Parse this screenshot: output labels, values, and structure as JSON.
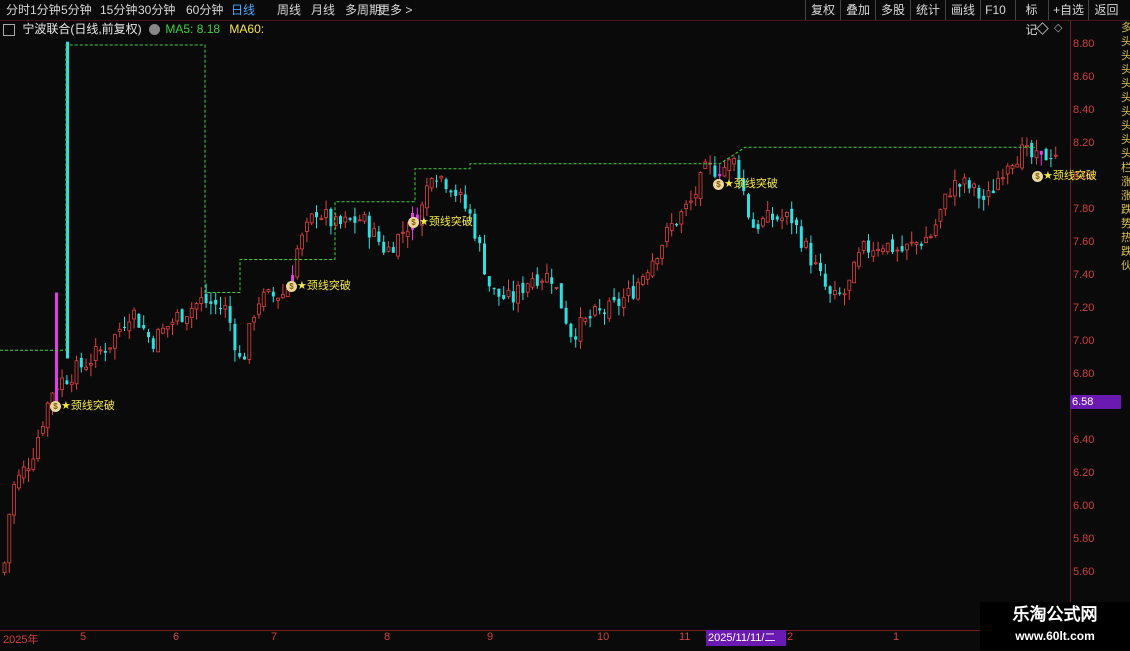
{
  "toolbar": {
    "periods": [
      "分时",
      "1分钟",
      "5分钟",
      "15分钟",
      "30分钟",
      "60分钟",
      "日线",
      "周线",
      "月线",
      "多周期",
      "更多 >"
    ],
    "active_period": "日线",
    "right_buttons": [
      "复权",
      "叠加",
      "多股",
      "统计",
      "画线",
      "F10",
      "标记",
      "+自选",
      "返回"
    ]
  },
  "info": {
    "title": "宁波联合(日线,前复权)",
    "ma5_label": "MA5:",
    "ma5_value": "8.18",
    "ma60_label": "MA60:"
  },
  "y_axis_labels": [
    "8.80",
    "8.60",
    "8.40",
    "8.20",
    "8.00",
    "7.80",
    "7.60",
    "7.40",
    "7.20",
    "7.00",
    "6.80",
    "6.40",
    "6.20",
    "6.00",
    "5.80",
    "5.60"
  ],
  "current_price": "6.58",
  "x_axis_labels": [
    "2025年",
    "5",
    "6",
    "7",
    "8",
    "9",
    "10",
    "11",
    "2025/11/11/二",
    "2",
    "1"
  ],
  "signal_label": "颈线突破",
  "sidebar_text": "多头头头头头头头头头栏涨涨跌势热跌伙",
  "watermark": {
    "line1": "乐淘公式网",
    "line2": "www.60lt.com"
  },
  "colors": {
    "up": "#e04040",
    "down": "#30e0e0",
    "highlight": "#e040e0",
    "ma60": "#40d040",
    "signal": "#f5e84a"
  },
  "chart_data": {
    "type": "candlestick",
    "ylim": [
      5.5,
      8.9
    ],
    "series": [
      {
        "name": "MA5",
        "value": 8.18
      }
    ]
  }
}
